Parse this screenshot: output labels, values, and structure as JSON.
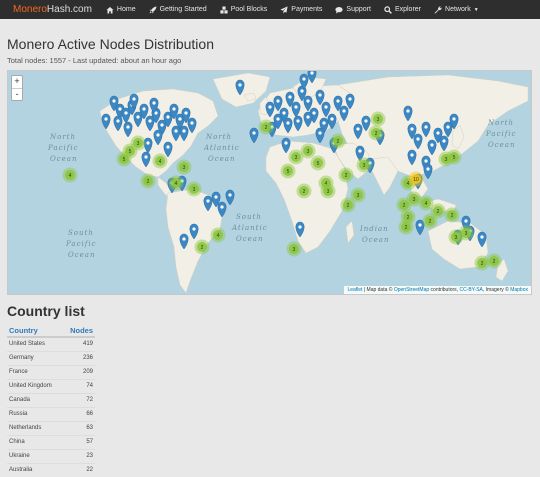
{
  "navbar": {
    "brand_main": "Monero",
    "brand_rest": "Hash.com",
    "items": [
      {
        "label": "Home",
        "icon": "home-icon"
      },
      {
        "label": "Getting Started",
        "icon": "rocket-icon"
      },
      {
        "label": "Pool Blocks",
        "icon": "cubes-icon"
      },
      {
        "label": "Payments",
        "icon": "paper-plane-icon"
      },
      {
        "label": "Support",
        "icon": "comments-icon"
      },
      {
        "label": "Explorer",
        "icon": "search-icon"
      },
      {
        "label": "Network",
        "icon": "wrench-icon"
      }
    ]
  },
  "page": {
    "title": "Monero Active Nodes Distribution",
    "subtitle": "Total nodes: 1557 - Last updated: about an hour ago"
  },
  "map": {
    "zoom_in": "+",
    "zoom_out": "-",
    "ocean_labels": {
      "north_pacific_1": "North",
      "north_pacific_2": "Pacific",
      "north_pacific_3": "Ocean",
      "north_atlantic_1": "North",
      "north_atlantic_2": "Atlantic",
      "north_atlantic_3": "Ocean",
      "south_atlantic_1": "South",
      "south_atlantic_2": "Atlantic",
      "south_atlantic_3": "Ocean",
      "south_pacific_1": "South",
      "south_pacific_2": "Pacific",
      "south_pacific_3": "Ocean",
      "indian_1": "Indian",
      "indian_2": "Ocean",
      "north_pacific_east_1": "North",
      "north_pacific_east_2": "Pacific",
      "north_pacific_east_3": "Ocean"
    },
    "attribution": {
      "leaflet": "Leaflet",
      "text1": " | Map data © ",
      "osm": "OpenStreetMap",
      "text2": " contributors, ",
      "license": "CC-BY-SA",
      "text3": ", Imagery © ",
      "mapbox": "Mapbox"
    },
    "clusters": [
      "4",
      "5",
      "5",
      "3",
      "4",
      "3",
      "4",
      "3",
      "2",
      "4",
      "2",
      "5",
      "3",
      "2",
      "3",
      "5",
      "4",
      "2",
      "3",
      "2",
      "3",
      "3",
      "2",
      "2",
      "4",
      "2",
      "10",
      "3",
      "4",
      "2",
      "5",
      "3",
      "3",
      "3",
      "2",
      "2",
      "2",
      "2",
      "2",
      "2",
      "3",
      "2",
      "3"
    ],
    "colors": {
      "ocean": "#b2d3df",
      "land": "#f2efe6",
      "marker": "#3c88c4",
      "cluster": "#8cc63f",
      "cluster_large": "#f0c419"
    }
  },
  "country_list": {
    "title": "Country list",
    "col_country": "Country",
    "col_nodes": "Nodes",
    "rows": [
      {
        "country": "United States",
        "nodes": "419"
      },
      {
        "country": "Germany",
        "nodes": "236"
      },
      {
        "country": "France",
        "nodes": "209"
      },
      {
        "country": "United Kingdom",
        "nodes": "74"
      },
      {
        "country": "Canada",
        "nodes": "72"
      },
      {
        "country": "Russia",
        "nodes": "66"
      },
      {
        "country": "Netherlands",
        "nodes": "63"
      },
      {
        "country": "China",
        "nodes": "57"
      },
      {
        "country": "Ukraine",
        "nodes": "23"
      },
      {
        "country": "Australia",
        "nodes": "22"
      }
    ]
  }
}
